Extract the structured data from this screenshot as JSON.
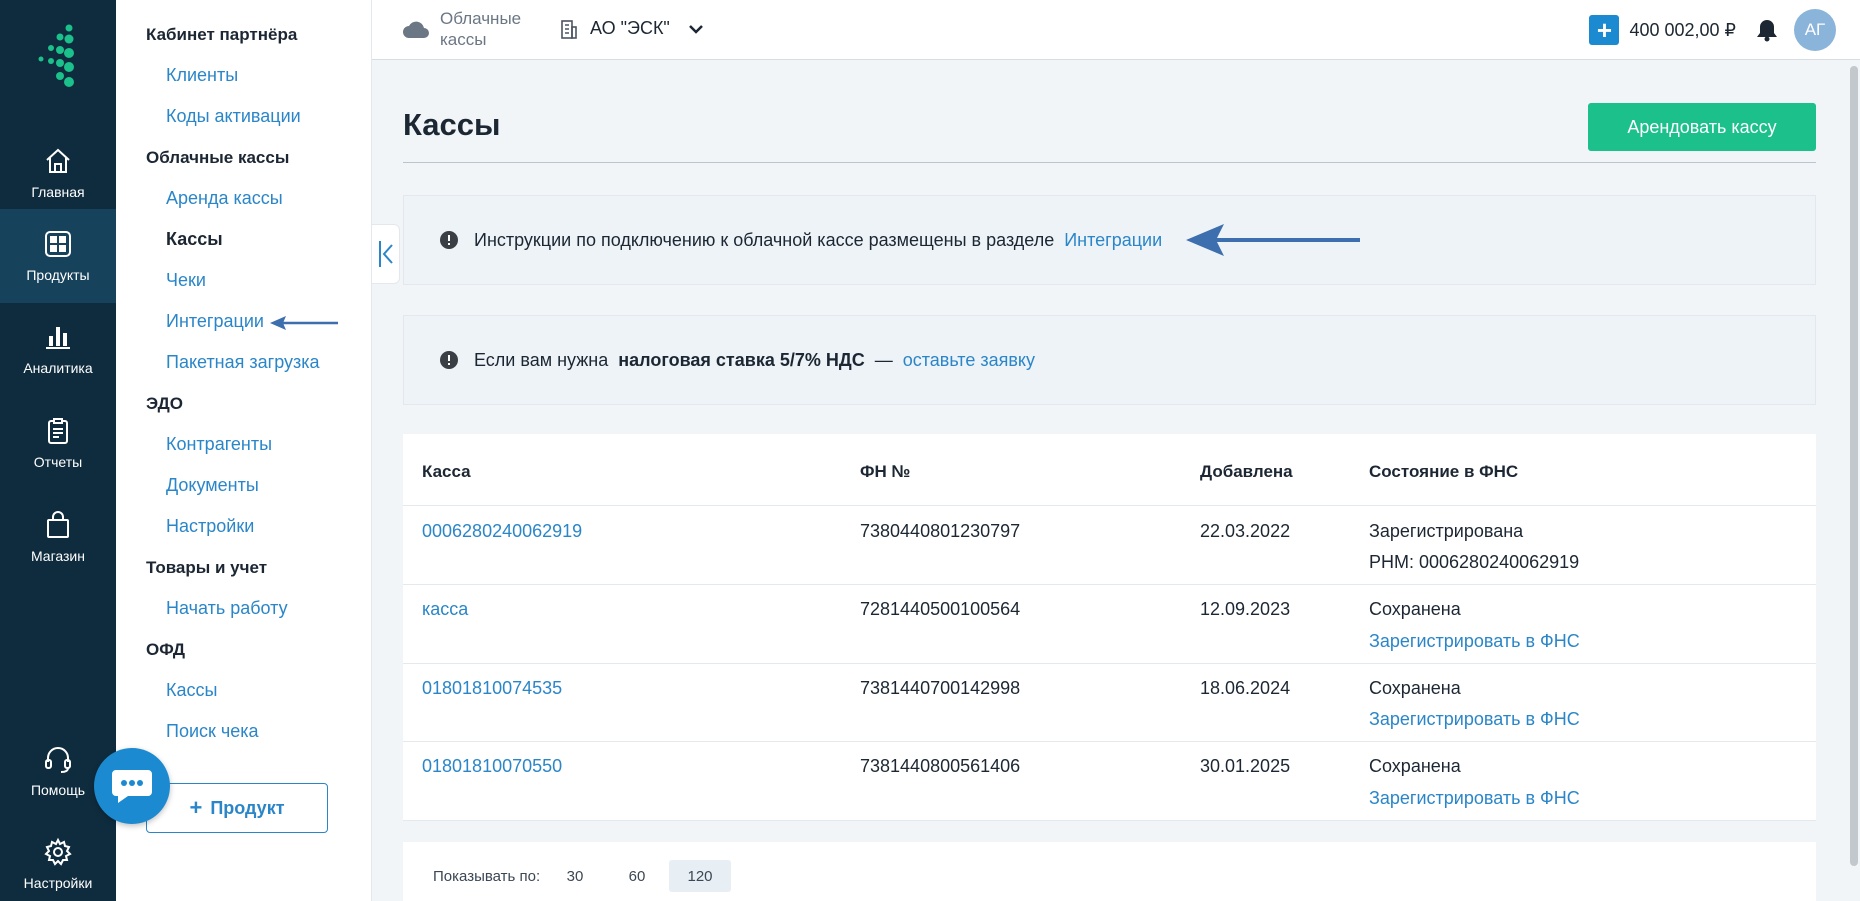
{
  "rail": {
    "items": [
      {
        "label": "Главная",
        "icon": "home-icon"
      },
      {
        "label": "Продукты",
        "icon": "grid-icon"
      },
      {
        "label": "Аналитика",
        "icon": "bar-chart-icon"
      },
      {
        "label": "Отчеты",
        "icon": "clipboard-icon"
      },
      {
        "label": "Магазин",
        "icon": "shopping-bag-icon"
      },
      {
        "label": "Помощь",
        "icon": "headset-icon"
      },
      {
        "label": "Настройки",
        "icon": "gear-icon"
      }
    ]
  },
  "subnav": {
    "groups": [
      {
        "title": "Кабинет партнёра",
        "links": [
          "Клиенты",
          "Коды активации"
        ]
      },
      {
        "title": "Облачные кассы",
        "links": [
          "Аренда кассы",
          "Кассы",
          "Чеки",
          "Интеграции",
          "Пакетная загрузка"
        ]
      },
      {
        "title": "ЭДО",
        "links": [
          "Контрагенты",
          "Документы",
          "Настройки"
        ]
      },
      {
        "title": "Товары и учет",
        "links": [
          "Начать работу"
        ]
      },
      {
        "title": "ОФД",
        "links": [
          "Кассы",
          "Поиск чека"
        ]
      }
    ],
    "current": "Кассы",
    "add_product": "Продукт"
  },
  "topbar": {
    "product_line1": "Облачные",
    "product_line2": "кассы",
    "org": "АО \"ЭСК\"",
    "balance": "400 002,00 ₽",
    "avatar": "АГ"
  },
  "main": {
    "title": "Кассы",
    "rent_button": "Арендовать кассу",
    "notice1": {
      "text": "Инструкции по подключению к облачной кассе размещены в разделе",
      "link": "Интеграции"
    },
    "notice2": {
      "text_before": "Если вам нужна",
      "bold": "налоговая ставка 5/7% НДС",
      "dash": "—",
      "link": "оставьте заявку"
    },
    "table": {
      "headers": [
        "Касса",
        "ФН №",
        "Добавлена",
        "Состояние в ФНС"
      ],
      "rows": [
        {
          "name": "0006280240062919",
          "fn": "7380440801230797",
          "added": "22.03.2022",
          "status": "Зарегистрирована",
          "status2": "РНМ: 0006280240062919",
          "status2_link": false
        },
        {
          "name": "касса",
          "fn": "7281440500100564",
          "added": "12.09.2023",
          "status": "Сохранена",
          "status2": "Зарегистрировать в ФНС",
          "status2_link": true
        },
        {
          "name": "01801810074535",
          "fn": "7381440700142998",
          "added": "18.06.2024",
          "status": "Сохранена",
          "status2": "Зарегистрировать в ФНС",
          "status2_link": true
        },
        {
          "name": "01801810070550",
          "fn": "7381440800561406",
          "added": "30.01.2025",
          "status": "Сохранена",
          "status2": "Зарегистрировать в ФНС",
          "status2_link": true
        }
      ]
    },
    "pager": {
      "label": "Показывать по:",
      "options": [
        "30",
        "60",
        "120"
      ],
      "selected": "120"
    }
  },
  "colors": {
    "rail_bg": "#0f2c3e",
    "accent": "#2a86c8",
    "rent": "#1bc08b",
    "logo": "#1bc08b",
    "arrow": "#3d6fae"
  }
}
